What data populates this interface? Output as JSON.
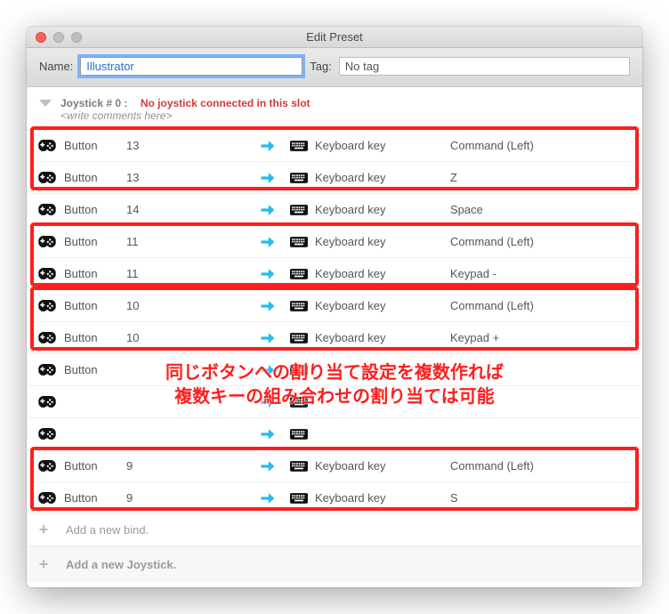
{
  "window": {
    "title": "Edit Preset"
  },
  "toolbar": {
    "name_label": "Name:",
    "name_value": "Illustrator",
    "tag_label": "Tag:",
    "tag_value": "No tag"
  },
  "joystick_header": {
    "title": "Joystick #  0 :",
    "warning": "No joystick connected in this slot",
    "hint": "<write comments here>"
  },
  "rows": [
    {
      "src_name": "Button",
      "src_num": "13",
      "tgt_kind": "Keyboard key",
      "tgt_val": "Command (Left)"
    },
    {
      "src_name": "Button",
      "src_num": "13",
      "tgt_kind": "Keyboard key",
      "tgt_val": "Z"
    },
    {
      "src_name": "Button",
      "src_num": "14",
      "tgt_kind": "Keyboard key",
      "tgt_val": "Space"
    },
    {
      "src_name": "Button",
      "src_num": "11",
      "tgt_kind": "Keyboard key",
      "tgt_val": "Command (Left)"
    },
    {
      "src_name": "Button",
      "src_num": "11",
      "tgt_kind": "Keyboard key",
      "tgt_val": "Keypad -"
    },
    {
      "src_name": "Button",
      "src_num": "10",
      "tgt_kind": "Keyboard key",
      "tgt_val": "Command (Left)"
    },
    {
      "src_name": "Button",
      "src_num": "10",
      "tgt_kind": "Keyboard key",
      "tgt_val": "Keypad +"
    },
    {
      "src_name": "Button",
      "src_num": "",
      "tgt_kind": "",
      "tgt_val": ""
    },
    {
      "src_name": "",
      "src_num": "",
      "tgt_kind": "",
      "tgt_val": ""
    },
    {
      "src_name": "",
      "src_num": "",
      "tgt_kind": "",
      "tgt_val": ""
    },
    {
      "src_name": "Button",
      "src_num": "9",
      "tgt_kind": "Keyboard key",
      "tgt_val": "Command (Left)"
    },
    {
      "src_name": "Button",
      "src_num": "9",
      "tgt_kind": "Keyboard key",
      "tgt_val": "S"
    }
  ],
  "add_bind": "Add a new bind.",
  "add_joy": "Add a new Joystick.",
  "annotation": {
    "line1": "同じボタンへの割り当て設定を複数作れば",
    "line2": "複数キーの組み合わせの割り当ては可能"
  }
}
